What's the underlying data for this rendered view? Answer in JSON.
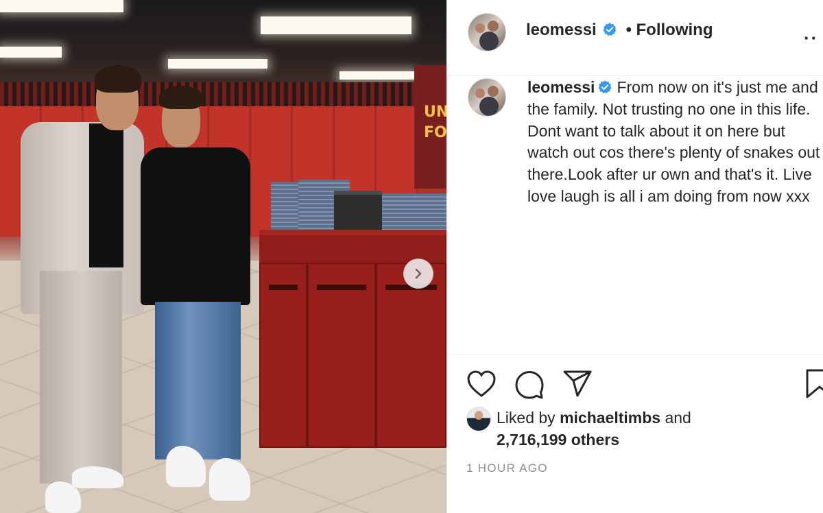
{
  "post": {
    "username": "leomessi",
    "verified": true,
    "follow_separator": "•",
    "follow_state": "Following",
    "more_icon": "more-horizontal-icon",
    "photo_banner_text": [
      "UNI",
      "FO"
    ]
  },
  "caption": {
    "username": "leomessi",
    "text": "From now on it's just me and the family. Not trusting no one in this life. Dont want to talk about it on here but watch out cos there's plenty of snakes out there.Look after ur own and that's it. Live love laugh is all i am doing from now xxx"
  },
  "actions": {
    "like_icon": "heart-icon",
    "comment_icon": "comment-icon",
    "share_icon": "paper-plane-icon",
    "save_icon": "bookmark-icon"
  },
  "likes": {
    "prefix": "Liked by ",
    "liker": "michaeltimbs",
    "middle": " and",
    "count": "2,716,199 others"
  },
  "timestamp": "1 HOUR AGO",
  "colors": {
    "text": "#262626",
    "muted": "#8e8e8e",
    "verified_blue": "#3897f0",
    "border": "#efefef"
  }
}
